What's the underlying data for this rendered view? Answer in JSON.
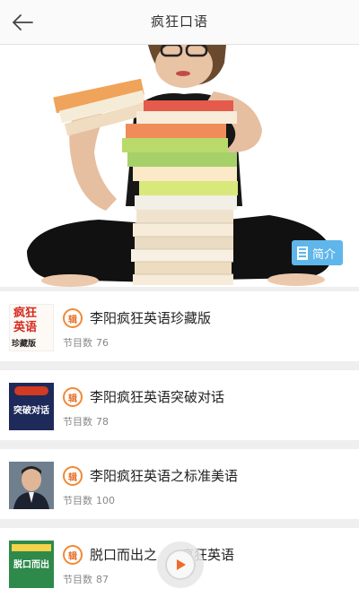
{
  "header": {
    "title": "疯狂口语"
  },
  "banner": {
    "intro_label": "简介"
  },
  "meta_label": "节目数",
  "items": [
    {
      "title": "李阳疯狂英语珍藏版",
      "count": "76",
      "cover_lines": [
        "疯狂",
        "英语",
        "珍藏版"
      ]
    },
    {
      "title": "李阳疯狂英语突破对话",
      "count": "78",
      "cover_lines": [
        "突破对话"
      ]
    },
    {
      "title": "李阳疯狂英语之标准美语",
      "count": "100",
      "cover_lines": []
    },
    {
      "title": "脱口而出之疯狂英语",
      "title_visible": "脱口而出之",
      "title_tail": "疯狂英语",
      "count": "87",
      "cover_lines": [
        "脱口而出"
      ]
    }
  ],
  "badge_label": "辑",
  "colors": {
    "accent": "#f08a35",
    "intro_bg": "#5fb6ea",
    "play": "#f06a28"
  }
}
